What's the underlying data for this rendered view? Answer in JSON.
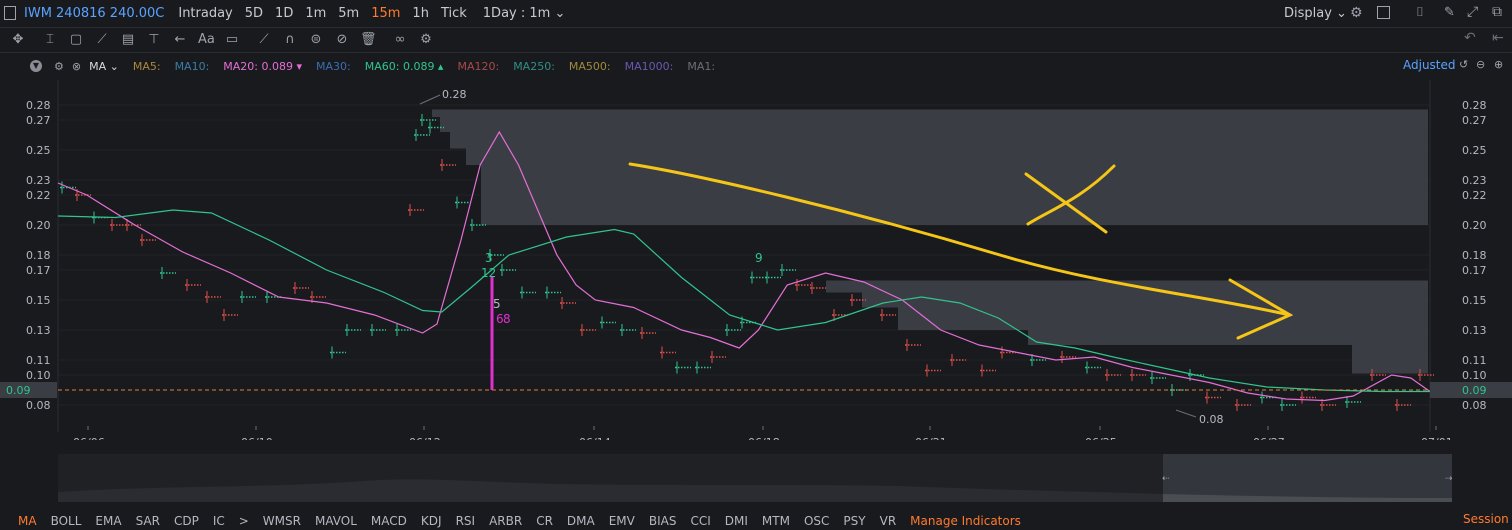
{
  "header": {
    "symbol": "IWM 240816 240.00C",
    "timeframes": [
      {
        "label": "Intraday",
        "active": false
      },
      {
        "label": "5D",
        "active": false
      },
      {
        "label": "1D",
        "active": false
      },
      {
        "label": "1m",
        "active": false
      },
      {
        "label": "5m",
        "active": false
      },
      {
        "label": "15m",
        "active": true
      },
      {
        "label": "1h",
        "active": false
      },
      {
        "label": "Tick",
        "active": false
      }
    ],
    "range_select": "1Day : 1m",
    "display_label": "Display"
  },
  "ma_bar": {
    "label": "MA",
    "items": [
      {
        "text": "MA5:",
        "color": "#a8893c"
      },
      {
        "text": "MA10:",
        "color": "#3a7ea8"
      },
      {
        "text": "MA20: 0.089 ▾",
        "color": "#e36fd6"
      },
      {
        "text": "MA30:",
        "color": "#3a6fb0"
      },
      {
        "text": "MA60: 0.089 ▴",
        "color": "#31c48d"
      },
      {
        "text": "MA120:",
        "color": "#a84a4a"
      },
      {
        "text": "MA250:",
        "color": "#2f8f86"
      },
      {
        "text": "MA500:",
        "color": "#a08a3c"
      },
      {
        "text": "MA1000:",
        "color": "#6a58b0"
      },
      {
        "text": "MA1:",
        "color": "#6b6e75"
      }
    ],
    "adjusted_label": "Adjusted"
  },
  "chart_data": {
    "type": "candlestick",
    "price_axis_ticks": [
      "0.28",
      "0.27",
      "0.25",
      "0.23",
      "0.22",
      "0.20",
      "0.18",
      "0.17",
      "0.15",
      "0.13",
      "0.11",
      "0.10",
      "0.08"
    ],
    "date_ticks": [
      "06/06",
      "06/10",
      "06/12",
      "06/14",
      "06/18",
      "06/21",
      "06/25",
      "06/27",
      "07/01"
    ],
    "current_price_label": "0.09",
    "high_label": "0.28",
    "low_label": "0.08",
    "annotations": [
      "3",
      "12",
      "9",
      "5",
      "6",
      "8"
    ],
    "ylim": [
      0.07,
      0.29
    ],
    "ma20_color": "#e36fd6",
    "ma60_color": "#31c48d",
    "ma20": [
      [
        0,
        0.228
      ],
      [
        30,
        0.22
      ],
      [
        80,
        0.2
      ],
      [
        130,
        0.182
      ],
      [
        180,
        0.168
      ],
      [
        230,
        0.152
      ],
      [
        280,
        0.148
      ],
      [
        330,
        0.14
      ],
      [
        380,
        0.128
      ],
      [
        395,
        0.134
      ],
      [
        420,
        0.19
      ],
      [
        440,
        0.24
      ],
      [
        460,
        0.262
      ],
      [
        480,
        0.24
      ],
      [
        500,
        0.21
      ],
      [
        520,
        0.18
      ],
      [
        540,
        0.16
      ],
      [
        560,
        0.15
      ],
      [
        600,
        0.145
      ],
      [
        650,
        0.13
      ],
      [
        680,
        0.125
      ],
      [
        710,
        0.118
      ],
      [
        730,
        0.13
      ],
      [
        760,
        0.16
      ],
      [
        800,
        0.168
      ],
      [
        840,
        0.162
      ],
      [
        880,
        0.15
      ],
      [
        920,
        0.13
      ],
      [
        960,
        0.12
      ],
      [
        1000,
        0.115
      ],
      [
        1040,
        0.11
      ],
      [
        1080,
        0.112
      ],
      [
        1120,
        0.105
      ],
      [
        1160,
        0.1
      ],
      [
        1200,
        0.095
      ],
      [
        1240,
        0.088
      ],
      [
        1280,
        0.084
      ],
      [
        1320,
        0.083
      ],
      [
        1350,
        0.086
      ],
      [
        1390,
        0.1
      ],
      [
        1410,
        0.098
      ],
      [
        1430,
        0.089
      ]
    ],
    "ma60": [
      [
        0,
        0.206
      ],
      [
        60,
        0.205
      ],
      [
        120,
        0.21
      ],
      [
        160,
        0.208
      ],
      [
        220,
        0.19
      ],
      [
        280,
        0.17
      ],
      [
        340,
        0.155
      ],
      [
        380,
        0.143
      ],
      [
        400,
        0.142
      ],
      [
        430,
        0.158
      ],
      [
        470,
        0.18
      ],
      [
        530,
        0.192
      ],
      [
        580,
        0.197
      ],
      [
        600,
        0.194
      ],
      [
        650,
        0.165
      ],
      [
        700,
        0.14
      ],
      [
        750,
        0.13
      ],
      [
        800,
        0.135
      ],
      [
        860,
        0.148
      ],
      [
        900,
        0.152
      ],
      [
        940,
        0.148
      ],
      [
        980,
        0.138
      ],
      [
        1020,
        0.122
      ],
      [
        1060,
        0.118
      ],
      [
        1100,
        0.112
      ],
      [
        1150,
        0.105
      ],
      [
        1200,
        0.098
      ],
      [
        1260,
        0.092
      ],
      [
        1320,
        0.09
      ],
      [
        1380,
        0.089
      ],
      [
        1430,
        0.089
      ]
    ]
  },
  "indicators": [
    {
      "label": "MA",
      "active": true
    },
    {
      "label": "BOLL",
      "active": false
    },
    {
      "label": "EMA",
      "active": false
    },
    {
      "label": "SAR",
      "active": false
    },
    {
      "label": "CDP",
      "active": false
    },
    {
      "label": "IC",
      "active": false
    },
    {
      "label": ">",
      "active": false
    },
    {
      "label": "WMSR",
      "active": false
    },
    {
      "label": "MAVOL",
      "active": false
    },
    {
      "label": "MACD",
      "active": false
    },
    {
      "label": "KDJ",
      "active": false
    },
    {
      "label": "RSI",
      "active": false
    },
    {
      "label": "ARBR",
      "active": false
    },
    {
      "label": "CR",
      "active": false
    },
    {
      "label": "DMA",
      "active": false
    },
    {
      "label": "EMV",
      "active": false
    },
    {
      "label": "BIAS",
      "active": false
    },
    {
      "label": "CCI",
      "active": false
    },
    {
      "label": "DMI",
      "active": false
    },
    {
      "label": "MTM",
      "active": false
    },
    {
      "label": "OSC",
      "active": false
    },
    {
      "label": "PSY",
      "active": false
    },
    {
      "label": "VR",
      "active": false
    }
  ],
  "manage_indicators": "Manage Indicators",
  "session_label": "Session"
}
